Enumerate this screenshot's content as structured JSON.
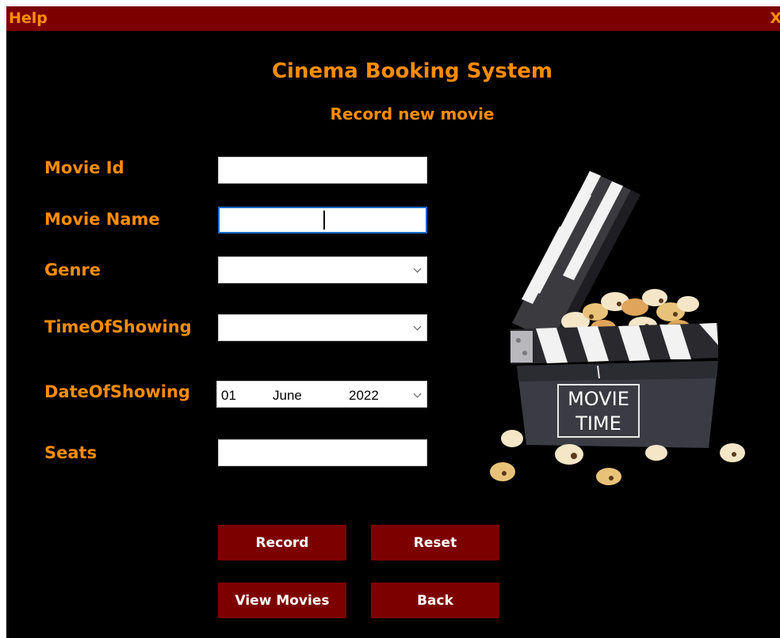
{
  "menu": {
    "help": "Help",
    "close": "X"
  },
  "header": {
    "title": "Cinema Booking System",
    "subtitle": "Record new movie"
  },
  "form": {
    "movie_id": {
      "label": "Movie Id",
      "value": ""
    },
    "movie_name": {
      "label": "Movie Name",
      "value": ""
    },
    "genre": {
      "label": "Genre",
      "value": ""
    },
    "time_of_showing": {
      "label": "TimeOfShowing",
      "value": ""
    },
    "date_of_showing": {
      "label": "DateOfShowing",
      "day": "01",
      "month": "June",
      "year": "2022"
    },
    "seats": {
      "label": "Seats",
      "value": ""
    }
  },
  "buttons": {
    "record": "Record",
    "reset": "Reset",
    "view_movies": "View Movies",
    "back": "Back"
  },
  "illustration": {
    "line1": "MOVIE",
    "line2": "TIME"
  },
  "colors": {
    "accent": "#ff8c00",
    "bar": "#7d0000",
    "background": "#000000"
  }
}
